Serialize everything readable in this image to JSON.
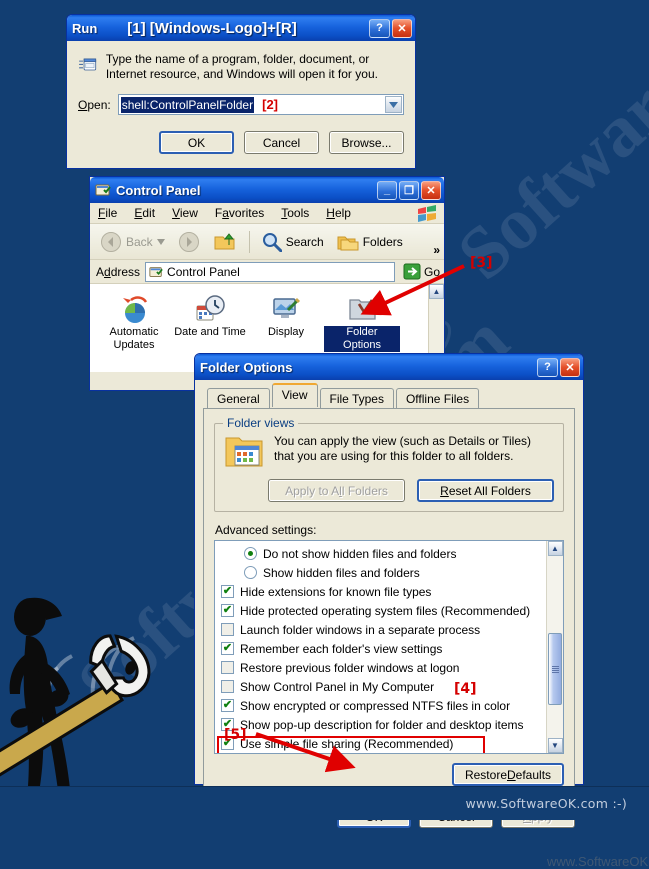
{
  "background": {
    "color": "#123E72",
    "watermark_text": "SoftwareOK.com"
  },
  "footer": {
    "text": "www.SoftwareOK.com  :-)"
  },
  "watermarks": {
    "control_panel_area": "www.SoftwareOK.com  :-)",
    "folder_options_area": "www.SoftwareOK.com  :-)"
  },
  "markers": {
    "step1": "[1]",
    "step2": "[2]",
    "step3": "[3]",
    "step4": "[4]",
    "step5": "[5]",
    "accent_color": "#d40000"
  },
  "run_dialog": {
    "title": "Run",
    "title_badge": "[1] [Windows-Logo]+[R]",
    "icon": "run-app-icon",
    "help_button": "?",
    "close_button": "✕",
    "description": "Type the name of a program, folder, document, or Internet resource, and Windows will open it for you.",
    "open_label": "Open:",
    "open_value": "shell:ControlPanelFolder",
    "open_marker": "[2]",
    "combo_arrow_icon": "chevron-down-icon",
    "buttons": {
      "ok": "OK",
      "cancel": "Cancel",
      "browse": "Browse..."
    }
  },
  "control_panel": {
    "title": "Control Panel",
    "icon": "control-panel-icon",
    "window_buttons": {
      "minimize": "_",
      "maximize": "❐",
      "close": "✕"
    },
    "menu": [
      "File",
      "Edit",
      "View",
      "Favorites",
      "Tools",
      "Help"
    ],
    "toolbar": {
      "back": "Back",
      "back_icon": "back-arrow-icon",
      "forward_icon": "forward-arrow-icon",
      "up_icon": "up-folder-icon",
      "search": "Search",
      "search_icon": "magnifier-icon",
      "folders": "Folders",
      "folders_icon": "folders-icon",
      "overflow": "»"
    },
    "address": {
      "label": "Address",
      "value": "Control Panel",
      "icon": "control-panel-icon",
      "dropdown_icon": "chevron-down-icon",
      "go_label": "Go",
      "go_icon": "go-arrow-icon"
    },
    "items": [
      {
        "label": "Automatic Updates",
        "icon": "automatic-updates-icon",
        "selected": false
      },
      {
        "label": "Date and Time",
        "icon": "date-time-icon",
        "selected": false
      },
      {
        "label": "Display",
        "icon": "display-icon",
        "selected": false
      },
      {
        "label": "Folder Options",
        "icon": "folder-options-icon",
        "selected": true
      }
    ]
  },
  "folder_options": {
    "title": "Folder Options",
    "help_button": "?",
    "close_button": "✕",
    "tabs": [
      {
        "label": "General",
        "active": false
      },
      {
        "label": "View",
        "active": true
      },
      {
        "label": "File Types",
        "active": false
      },
      {
        "label": "Offline Files",
        "active": false
      }
    ],
    "folder_views": {
      "legend": "Folder views",
      "icon": "folder-view-icon",
      "description": "You can apply the view (such as Details or Tiles) that you are using for this folder to all folders.",
      "apply_all": "Apply to All Folders",
      "apply_all_disabled": true,
      "reset_all": "Reset All Folders"
    },
    "advanced_label": "Advanced settings:",
    "advanced_items": [
      {
        "type": "radio",
        "label": "Do not show hidden files and folders",
        "checked": true,
        "indent": true
      },
      {
        "type": "radio",
        "label": "Show hidden files and folders",
        "checked": false,
        "indent": true
      },
      {
        "type": "checkbox",
        "label": "Hide extensions for known file types",
        "checked": true,
        "indent": false
      },
      {
        "type": "checkbox",
        "label": "Hide protected operating system files (Recommended)",
        "checked": true,
        "indent": false
      },
      {
        "type": "checkbox",
        "label": "Launch folder windows in a separate process",
        "checked": false,
        "indent": false
      },
      {
        "type": "checkbox",
        "label": "Remember each folder's view settings",
        "checked": true,
        "indent": false
      },
      {
        "type": "checkbox",
        "label": "Restore previous folder windows at logon",
        "checked": false,
        "indent": false
      },
      {
        "type": "checkbox",
        "label": "Show Control Panel in My Computer",
        "checked": false,
        "indent": false
      },
      {
        "type": "checkbox",
        "label": "Show encrypted or compressed NTFS files in color",
        "checked": true,
        "indent": false
      },
      {
        "type": "checkbox",
        "label": "Show pop-up description for folder and desktop items",
        "checked": true,
        "indent": false
      },
      {
        "type": "checkbox",
        "label": "Use simple file sharing (Recommended)",
        "checked": true,
        "indent": false,
        "highlighted": true
      }
    ],
    "restore_defaults": "Restore Defaults",
    "buttons": {
      "ok": "OK",
      "cancel": "Cancel",
      "apply": "Apply",
      "apply_disabled": true
    },
    "scrollbar": {
      "up_icon": "scroll-up-icon",
      "down_icon": "scroll-down-icon"
    }
  }
}
